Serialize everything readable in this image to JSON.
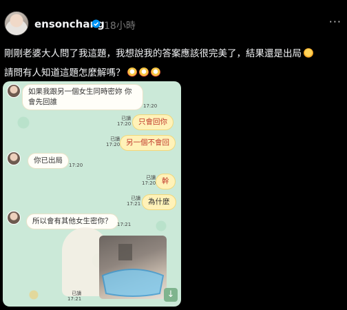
{
  "post": {
    "username": "ensonchang",
    "time": "18小時",
    "caption_line1": "剛剛老婆大人問了我這題，我想說我的答案應該很完美了，結果還是出局",
    "caption_line2": "請問有人知道這題怎麼解嗎？",
    "icons": [
      "verified-icon",
      "more-icon",
      "woman-gesturing-no-emoji",
      "screaming-face-emoji"
    ]
  },
  "chat": {
    "messages": [
      {
        "from": "other",
        "text_line1": "如果我跟另一個女生同時密妳 你",
        "text_line2": "會先回誰",
        "time": "17:20"
      },
      {
        "from": "me",
        "text": "只會回你",
        "read": "已讀",
        "time": "17:20"
      },
      {
        "from": "me",
        "text": "另一個不會回",
        "read": "已讀",
        "time": "17:20"
      },
      {
        "from": "other",
        "text": "你已出局",
        "time": "17:20"
      },
      {
        "from": "me",
        "text": "幹",
        "read": "已讀",
        "time": "17:20"
      },
      {
        "from": "me",
        "text": "為什麼",
        "read": "已讀",
        "time": "17:21"
      },
      {
        "from": "other",
        "text": "所以會有其他女生密你？",
        "time": "17:21"
      },
      {
        "from": "me",
        "sticker": "blurred-photo-sticker",
        "read": "已讀",
        "time": "17:21"
      }
    ],
    "scroll_icon": "↓"
  }
}
